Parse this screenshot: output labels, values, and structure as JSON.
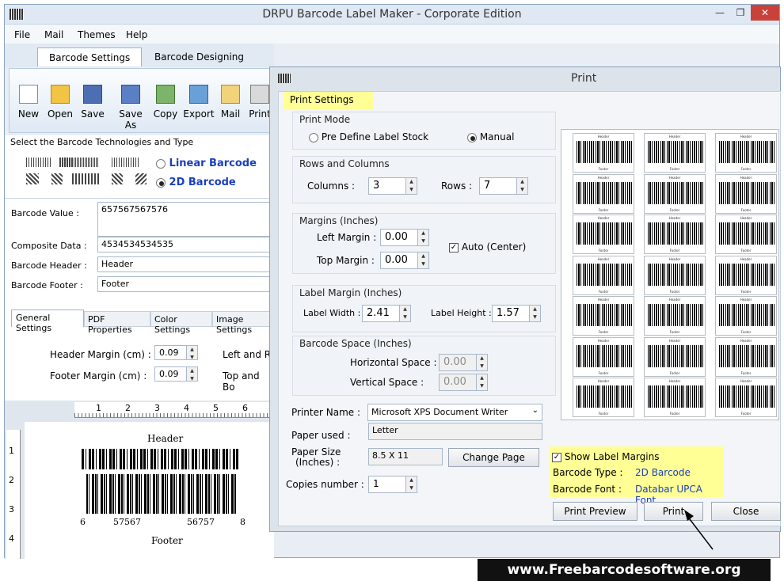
{
  "app": {
    "title": "DRPU Barcode Label Maker - Corporate Edition",
    "menu": [
      "File",
      "Mail",
      "Themes",
      "Help"
    ],
    "tabs": [
      "Barcode Settings",
      "Barcode Designing View"
    ],
    "toolbar": [
      "New",
      "Open",
      "Save",
      "Save As",
      "Copy",
      "Export",
      "Mail",
      "Print"
    ]
  },
  "left": {
    "technology_label": "Select the Barcode Technologies and Type",
    "linear": "Linear Barcode",
    "twod": "2D Barcode",
    "fields": [
      {
        "label": "Barcode Value :",
        "value": "657567567576"
      },
      {
        "label": "Composite Data :",
        "value": "4534534534535"
      },
      {
        "label": "Barcode Header :",
        "value": "Header"
      },
      {
        "label": "Barcode Footer :",
        "value": "Footer"
      }
    ],
    "subtabs": [
      "General Settings",
      "PDF Properties",
      "Color Settings",
      "Image Settings"
    ],
    "header_margin_label": "Header Margin (cm) :",
    "header_margin": "0.09",
    "footer_margin_label": "Footer Margin (cm) :",
    "footer_margin": "0.09",
    "left_right_label": "Left and R",
    "top_bottom_label": "Top and Bo",
    "ruler_ticks": [
      "1",
      "2",
      "3",
      "4",
      "5",
      "6"
    ],
    "vruler_ticks": [
      "1",
      "2",
      "3",
      "4"
    ],
    "preview": {
      "header": "Header",
      "footer": "Footer",
      "digits": [
        "6",
        "57567",
        "56757",
        "8"
      ]
    }
  },
  "print": {
    "title": "Print",
    "section": "Print Settings",
    "print_mode": {
      "title": "Print Mode",
      "opt1": "Pre Define Label Stock",
      "opt2": "Manual"
    },
    "rows_cols": {
      "title": "Rows and Columns",
      "columns_label": "Columns :",
      "columns": "3",
      "rows_label": "Rows :",
      "rows": "7"
    },
    "margins": {
      "title": "Margins (Inches)",
      "left_label": "Left Margin :",
      "left": "0.00",
      "top_label": "Top Margin :",
      "top": "0.00",
      "auto": "Auto (Center)"
    },
    "label_margin": {
      "title": "Label Margin (Inches)",
      "width_label": "Label Width :",
      "width": "2.41",
      "height_label": "Label Height :",
      "height": "1.57"
    },
    "barcode_space": {
      "title": "Barcode Space (Inches)",
      "h_label": "Horizontal Space :",
      "h": "0.00",
      "v_label": "Vertical Space :",
      "v": "0.00"
    },
    "printer_label": "Printer Name :",
    "printer": "Microsoft XPS Document Writer",
    "paper_label": "Paper used :",
    "paper": "Letter",
    "size_label1": "Paper Size",
    "size_label2": "(Inches) :",
    "size": "8.5 X 11",
    "change_page": "Change Page",
    "copies_label": "Copies number :",
    "copies": "1",
    "show_margins": "Show Label Margins",
    "type_label": "Barcode Type :",
    "type": "2D Barcode",
    "font_label": "Barcode Font :",
    "font": "Databar UPCA Font",
    "buttons": {
      "preview": "Print Preview",
      "print": "Print",
      "close": "Close"
    },
    "thumb_header": "Header",
    "thumb_footer": "Footer"
  },
  "watermark": "www.Freebarcodesoftware.org"
}
